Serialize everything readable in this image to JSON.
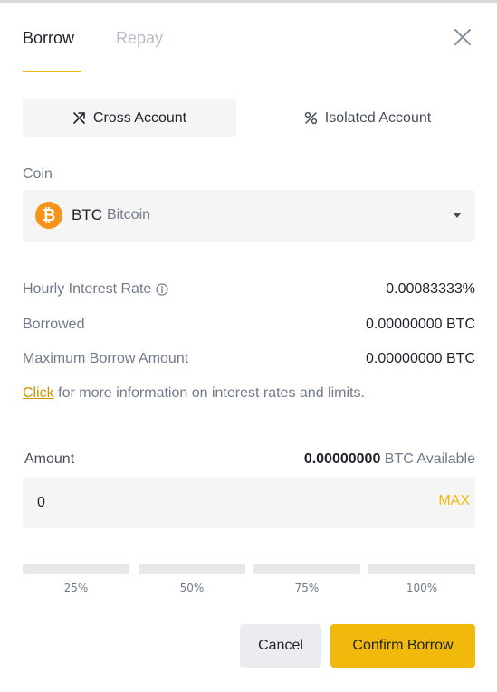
{
  "tabs": {
    "borrow": "Borrow",
    "repay": "Repay"
  },
  "mode": {
    "cross": "Cross Account",
    "isolated": "Isolated Account"
  },
  "coin": {
    "label": "Coin",
    "symbol": "BTC",
    "name": "Bitcoin",
    "icon_glyph": "₿",
    "icon_color": "#f7931a"
  },
  "info": {
    "rate_label": "Hourly Interest Rate",
    "rate_value": "0.00083333%",
    "borrowed_label": "Borrowed",
    "borrowed_value": "0.00000000 BTC",
    "max_label": "Maximum Borrow Amount",
    "max_value": "0.00000000 BTC"
  },
  "more_info": {
    "link": "Click",
    "text": " for more information on interest rates and limits."
  },
  "amount": {
    "label": "Amount",
    "available_value": "0.00000000",
    "available_text": " BTC Available",
    "input_value": "0",
    "max": "MAX"
  },
  "percentages": [
    "25%",
    "50%",
    "75%",
    "100%"
  ],
  "buttons": {
    "cancel": "Cancel",
    "confirm": "Confirm Borrow"
  },
  "colors": {
    "accent": "#f0b90b",
    "link": "#c99400",
    "muted": "#707a8a",
    "surface": "#f5f5f5"
  }
}
